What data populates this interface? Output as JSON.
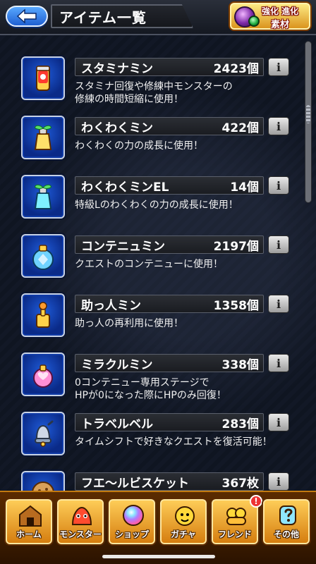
{
  "header": {
    "title": "アイテム一覧",
    "evo_button": {
      "line1": "強化 進化",
      "line2": "素材"
    }
  },
  "items": [
    {
      "name": "スタミナミン",
      "count": "2423個",
      "desc": "スタミナ回復や修練中モンスターの\n修練の時間短縮に使用！",
      "icon": "stamina-can-icon"
    },
    {
      "name": "わくわくミン",
      "count": "422個",
      "desc": "わくわくの力の成長に使用！",
      "icon": "sprout-bottle-icon"
    },
    {
      "name": "わくわくミンEL",
      "count": "14個",
      "desc": "特級Lのわくわくの力の成長に使用！",
      "icon": "sprout-bottle-el-icon"
    },
    {
      "name": "コンテニュミン",
      "count": "2197個",
      "desc": "クエストのコンテニューに使用！",
      "icon": "continue-potion-icon"
    },
    {
      "name": "助っ人ミン",
      "count": "1358個",
      "desc": "助っ人の再利用に使用！",
      "icon": "helper-bottle-icon"
    },
    {
      "name": "ミラクルミン",
      "count": "338個",
      "desc": "0コンテニュー専用ステージで\nHPが0になった際にHPのみ回復！",
      "icon": "miracle-potion-icon"
    },
    {
      "name": "トラベルベル",
      "count": "283個",
      "desc": "タイムシフトで好きなクエストを復活可能！",
      "icon": "travel-bell-icon"
    },
    {
      "name": "フエ〜ルビスケット",
      "count": "367枚",
      "desc": "",
      "icon": "biscuit-icon"
    }
  ],
  "nav": {
    "tabs": [
      {
        "label": "ホーム",
        "icon": "home-icon"
      },
      {
        "label": "モンスター",
        "icon": "monster-icon"
      },
      {
        "label": "ショップ",
        "icon": "shop-orb-icon"
      },
      {
        "label": "ガチャ",
        "icon": "gacha-icon"
      },
      {
        "label": "フレンド",
        "icon": "friends-icon"
      },
      {
        "label": "その他",
        "icon": "other-icon"
      }
    ],
    "friend_badge": "!"
  },
  "colors": {
    "header_bg": "#1b1f27",
    "back_button_blue": "#2f7bff",
    "nav_orange": "#f0a320",
    "list_bg": "#141a26"
  }
}
